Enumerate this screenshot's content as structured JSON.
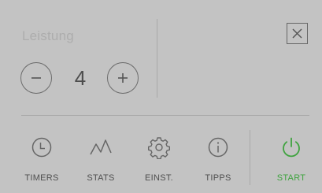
{
  "power": {
    "label": "Leistung",
    "value": "4"
  },
  "nav": {
    "timers": "TIMERS",
    "stats": "STATS",
    "einst": "EINST.",
    "tipps": "TIPPS",
    "start": "START"
  },
  "colors": {
    "background": "#c3c3c3",
    "icon": "#666666",
    "text": "#4f4f4f",
    "label_muted": "#adadad",
    "start": "#3fa33f"
  },
  "icons": {
    "minus": "minus-circle-icon",
    "plus": "plus-circle-icon",
    "close": "close-icon",
    "timers": "clock-icon",
    "stats": "line-chart-icon",
    "einst": "gear-icon",
    "tipps": "info-icon",
    "start": "power-icon"
  }
}
